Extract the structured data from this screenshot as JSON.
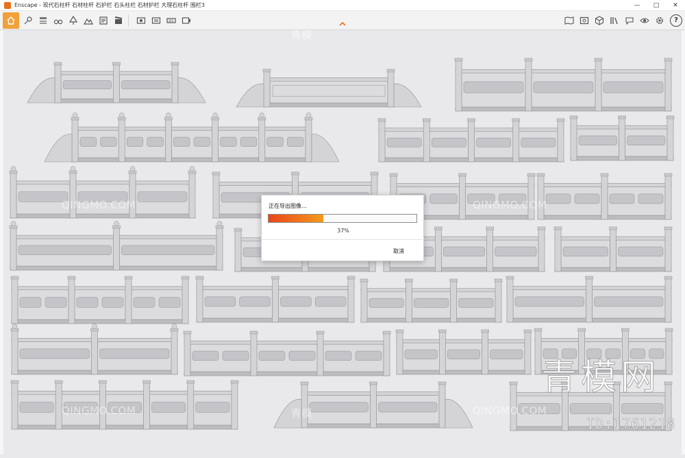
{
  "window": {
    "app_name": "Enscape",
    "title": "Enscape - 现代石柱杆 石材柱杆 石护栏 石头柱栏 石材护栏 大理石柱杆 围栏3",
    "accent_color": "#e8711f"
  },
  "toolbar": {
    "left_icons": [
      "home-icon",
      "location-pin-icon",
      "bim-icon",
      "binoculars-icon",
      "tree-icon",
      "mountain-icon",
      "layers-icon",
      "clapper-icon"
    ],
    "export_icons": [
      "screenshot-icon",
      "batch-render-icon",
      "panorama-icon",
      "video-export-icon"
    ],
    "right_icons": [
      "map-icon",
      "render-view-icon",
      "cube-icon",
      "library-icon",
      "chat-icon",
      "eye-icon",
      "settings-icon"
    ],
    "help_label": "?"
  },
  "dialog": {
    "title": "正在导出图像…",
    "progress_percent": 37,
    "progress_label": "37%",
    "cancel_label": "取消",
    "progress_colors": [
      "#e8461b",
      "#f59a1c"
    ]
  },
  "watermarks": {
    "small_text": "QINGMO.COM",
    "cn_text": "青模",
    "big_text": "青模网",
    "id_text": "ID:1761218"
  }
}
